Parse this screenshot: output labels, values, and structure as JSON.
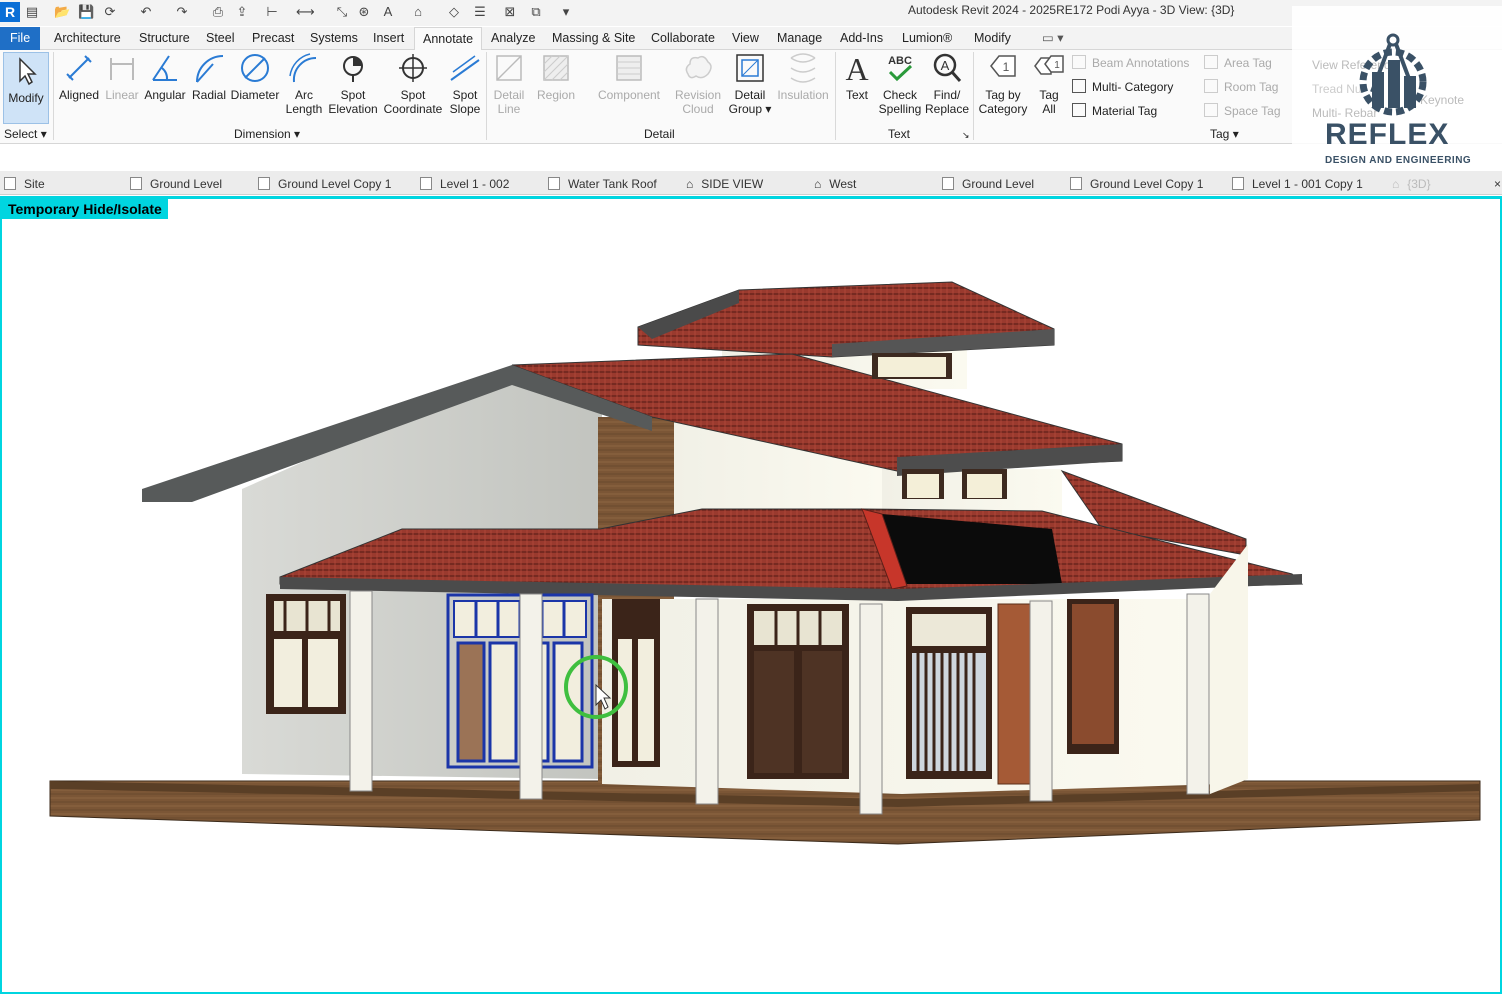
{
  "window_title": "Autodesk Revit 2024 - 2025RE172 Podi Ayya - 3D View: {3D}",
  "app_logo": "R",
  "menu": {
    "tabs": [
      "File",
      "Architecture",
      "Structure",
      "Steel",
      "Precast",
      "Systems",
      "Insert",
      "Annotate",
      "Analyze",
      "Massing & Site",
      "Collaborate",
      "View",
      "Manage",
      "Add-Ins",
      "Lumion®",
      "Modify"
    ],
    "active": "Annotate"
  },
  "ribbon": {
    "select": {
      "modify": "Modify",
      "panel": "Select"
    },
    "dimension": {
      "panel": "Dimension",
      "aligned": "Aligned",
      "linear": "Linear",
      "angular": "Angular",
      "radial": "Radial",
      "diameter": "Diameter",
      "arc_length_1": "Arc",
      "arc_length_2": "Length",
      "spot_elev_1": "Spot",
      "spot_elev_2": "Elevation",
      "spot_coord_1": "Spot",
      "spot_coord_2": "Coordinate",
      "spot_slope_1": "Spot",
      "spot_slope_2": "Slope"
    },
    "detail": {
      "panel": "Detail",
      "detail_line_1": "Detail",
      "detail_line_2": "Line",
      "region": "Region",
      "component": "Component",
      "revision_cloud_1": "Revision",
      "revision_cloud_2": "Cloud",
      "detail_group_1": "Detail",
      "detail_group_2": "Group",
      "insulation": "Insulation"
    },
    "text": {
      "panel": "Text",
      "text": "Text",
      "check_spelling_1": "Check",
      "check_spelling_2": "Spelling",
      "find_replace_1": "Find/",
      "find_replace_2": "Replace",
      "abc": "ABC"
    },
    "tag": {
      "panel": "Tag",
      "tag_by_category_1": "Tag by",
      "tag_by_category_2": "Category",
      "tag_all_1": "Tag",
      "tag_all_2": "All",
      "beam_annotations": "Beam  Annotations",
      "multi_category": "Multi- Category",
      "material_tag": "Material  Tag",
      "area_tag": "Area  Tag",
      "room_tag": "Room  Tag",
      "space_tag": "Space  Tag",
      "view_reference": "View  Reference",
      "tread_number": "Tread  Nu",
      "multi_rebar": "Multi- Rebar",
      "keynote": "Keynote"
    }
  },
  "brand": {
    "name": "REFLEX",
    "tagline": "DESIGN AND ENGINEERING"
  },
  "view_tabs": [
    "Site",
    "Ground Level",
    "Ground Level Copy 1",
    "Level 1 - 002",
    "Water Tank Roof",
    "SIDE VIEW",
    "West",
    "Ground Level",
    "Ground Level Copy 1",
    "Level 1 - 001 Copy 1",
    "{3D}"
  ],
  "viewport": {
    "mode_label": "Temporary Hide/Isolate",
    "isolate_color": "#00d5e0"
  }
}
